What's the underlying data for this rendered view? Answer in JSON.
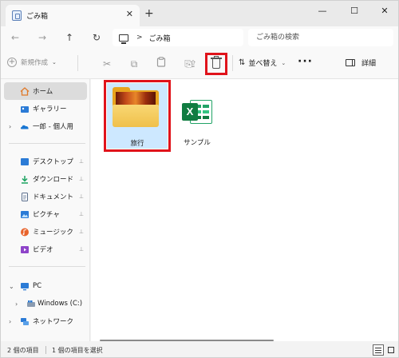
{
  "window": {
    "tab_title": "ごみ箱",
    "tab_close": "✕",
    "new_tab": "+",
    "minimize": "—",
    "maximize": "☐",
    "close": "✕"
  },
  "nav": {
    "back": "←",
    "forward": "→",
    "up": "↑",
    "refresh": "↻"
  },
  "address": {
    "separator": ">",
    "path": "ごみ箱"
  },
  "search": {
    "placeholder": "ごみ箱の検索"
  },
  "toolbar": {
    "new_label": "新規作成",
    "new_caret": "⌄",
    "cut": "✂",
    "copy": "⧉",
    "paste": "📋",
    "rename": "⎘",
    "share": "⇪",
    "sort_label": "並べ替え",
    "sort_icon": "⇅",
    "sort_caret": "⌄",
    "more": "···",
    "details_label": "詳細"
  },
  "sidebar": {
    "items": [
      {
        "label": "ホーム",
        "icon": "home-icon",
        "selected": true
      },
      {
        "label": "ギャラリー",
        "icon": "gallery-icon"
      },
      {
        "label": "一郎 - 個人用",
        "icon": "onedrive-icon",
        "expandable": true
      },
      {
        "label": "デスクトップ",
        "icon": "desktop-icon",
        "pinned": true
      },
      {
        "label": "ダウンロード",
        "icon": "download-icon",
        "pinned": true
      },
      {
        "label": "ドキュメント",
        "icon": "documents-icon",
        "pinned": true
      },
      {
        "label": "ピクチャ",
        "icon": "pictures-icon",
        "pinned": true
      },
      {
        "label": "ミュージック",
        "icon": "music-icon",
        "pinned": true
      },
      {
        "label": "ビデオ",
        "icon": "videos-icon",
        "pinned": true
      },
      {
        "label": "PC",
        "icon": "pc-icon",
        "expanded": true
      },
      {
        "label": "Windows (C:)",
        "icon": "drive-icon",
        "expandable": true
      },
      {
        "label": "ネットワーク",
        "icon": "network-icon",
        "expandable": true
      }
    ],
    "chevron_right": "›",
    "chevron_down": "⌄",
    "pin": "📌"
  },
  "files": [
    {
      "name": "旅行",
      "type": "folder",
      "selected": true
    },
    {
      "name": "サンプル",
      "type": "excel"
    }
  ],
  "excel_letter": "X",
  "status": {
    "item_count": "2 個の項目",
    "selected_count": "1 個の項目を選択"
  },
  "colors": {
    "highlight_red": "#e0131b",
    "selection_blue": "#cde8ff",
    "excel_green": "#107c41",
    "folder_yellow": "#f0c04a"
  }
}
